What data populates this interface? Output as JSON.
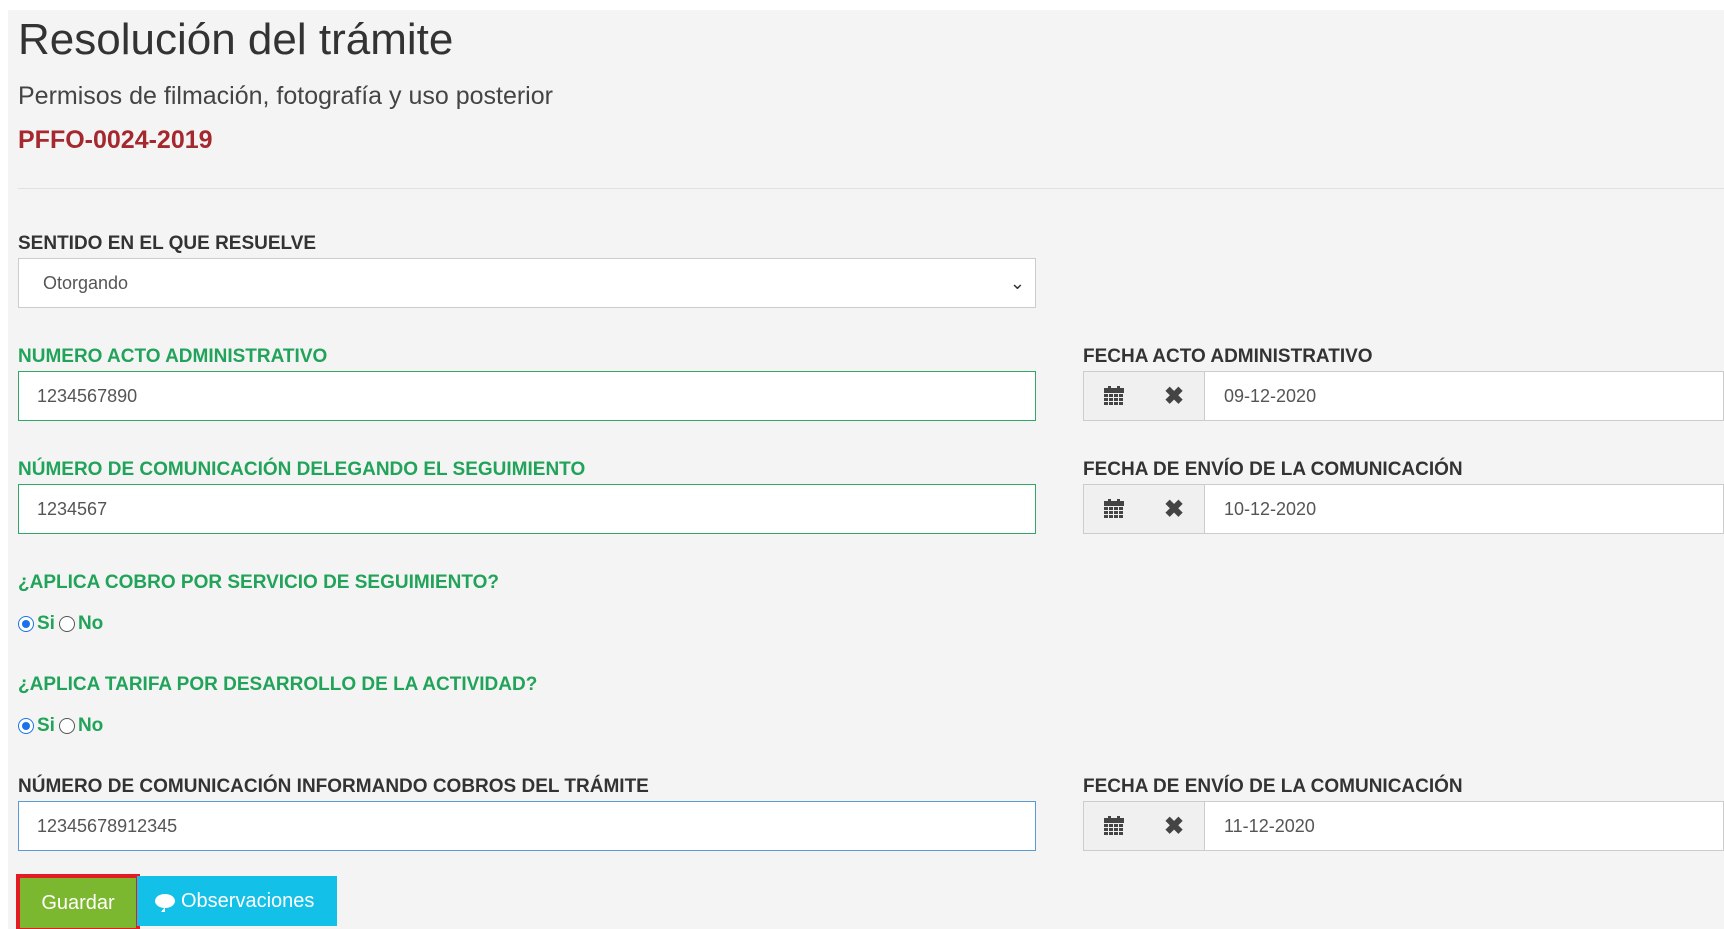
{
  "header": {
    "title": "Resolución del trámite",
    "subtitle": "Permisos de filmación, fotografía y uso posterior",
    "code": "PFFO-0024-2019"
  },
  "form": {
    "sentido": {
      "label": "SENTIDO EN EL QUE RESUELVE",
      "value": "Otorgando"
    },
    "numero_acto": {
      "label": "NUMERO ACTO ADMINISTRATIVO",
      "value": "1234567890"
    },
    "fecha_acto": {
      "label": "FECHA ACTO ADMINISTRATIVO",
      "value": "09-12-2020"
    },
    "numero_comunicacion": {
      "label": "NÚMERO DE COMUNICACIÓN DELEGANDO EL SEGUIMIENTO",
      "value": "1234567"
    },
    "fecha_envio_1": {
      "label": "FECHA DE ENVÍO DE LA COMUNICACIÓN",
      "value": "10-12-2020"
    },
    "cobro_seguimiento": {
      "label": "¿APLICA COBRO POR SERVICIO DE SEGUIMIENTO?",
      "opt_si": "Si",
      "opt_no": "No",
      "selected": "Si"
    },
    "tarifa_actividad": {
      "label": "¿APLICA TARIFA POR DESARROLLO DE LA ACTIVIDAD?",
      "opt_si": "Si",
      "opt_no": "No",
      "selected": "Si"
    },
    "numero_cobros": {
      "label": "NÚMERO DE COMUNICACIÓN INFORMANDO COBROS DEL TRÁMITE",
      "value": "12345678912345"
    },
    "fecha_envio_2": {
      "label": "FECHA DE ENVÍO DE LA COMUNICACIÓN",
      "value": "11-12-2020"
    }
  },
  "buttons": {
    "save": "Guardar",
    "observaciones": "Observaciones"
  },
  "icons": [
    "calendar-icon",
    "clear-icon",
    "chevron-down-icon",
    "comment-icon"
  ]
}
